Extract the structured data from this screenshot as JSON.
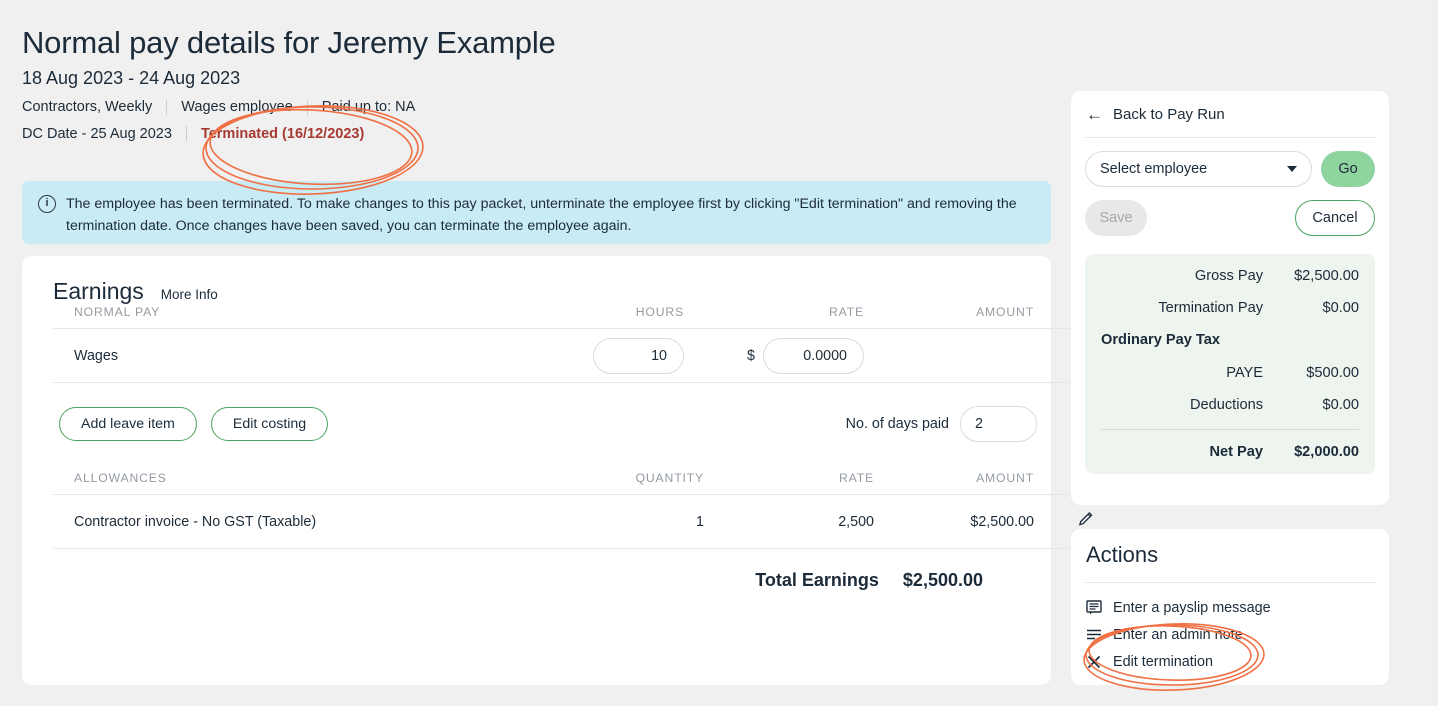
{
  "header": {
    "title": "Normal pay details for Jeremy Example",
    "date_range": "18 Aug 2023 - 24 Aug 2023",
    "meta1": "Contractors, Weekly",
    "meta2": "Wages employee",
    "meta3": "Paid up to: NA",
    "dc_date": "DC Date - 25 Aug 2023",
    "terminated_badge": "Terminated (16/12/2023)",
    "terminated_color": "#a63a32"
  },
  "banner": {
    "icon": "info-circle-icon",
    "text": "The employee has been terminated. To make changes to this pay packet, unterminate the employee first by clicking \"Edit termination\" and removing the termination date. Once changes have been saved, you can terminate the employee again.",
    "background": "#c9ebf6"
  },
  "earnings": {
    "title": "Earnings",
    "more_info": "More Info",
    "normal_pay": {
      "columns": [
        "NORMAL PAY",
        "HOURS",
        "RATE",
        "AMOUNT"
      ],
      "rows": [
        {
          "name": "Wages",
          "hours": "10",
          "currency_symbol": "$",
          "rate": "0.0000",
          "amount": ""
        }
      ]
    },
    "buttons": {
      "add_leave_item": "Add leave item",
      "edit_costing": "Edit costing"
    },
    "days_paid": {
      "label": "No. of days paid",
      "value": "2"
    },
    "allowances": {
      "columns": [
        "ALLOWANCES",
        "QUANTITY",
        "RATE",
        "AMOUNT"
      ],
      "rows": [
        {
          "name": "Contractor invoice - No GST (Taxable)",
          "quantity": "1",
          "rate": "2,500",
          "amount": "$2,500.00",
          "edit_icon": "pencil-icon"
        }
      ]
    },
    "total": {
      "label": "Total Earnings",
      "value": "$2,500.00"
    }
  },
  "pay_panel": {
    "back_link": "Back to Pay Run",
    "back_icon": "arrow-left-icon",
    "employee_select": {
      "value": "Select employee",
      "caret": "chevron-down-icon"
    },
    "go_button": "Go",
    "go_color": "#8ed49f",
    "save_button": "Save",
    "cancel_button": "Cancel",
    "summary": {
      "gross_pay_label": "Gross Pay",
      "gross_pay_value": "$2,500.00",
      "termination_pay_label": "Termination Pay",
      "termination_pay_value": "$0.00",
      "section_label": "Ordinary Pay Tax",
      "paye_label": "PAYE",
      "paye_value": "$500.00",
      "deductions_label": "Deductions",
      "deductions_value": "$0.00",
      "net_pay_label": "Net Pay",
      "net_pay_value": "$2,000.00"
    }
  },
  "actions": {
    "title": "Actions",
    "items": [
      {
        "label": "Enter a payslip message",
        "icon": "message-icon"
      },
      {
        "label": "Enter an admin note",
        "icon": "note-lines-icon"
      },
      {
        "label": "Edit termination",
        "icon": "close-x-icon"
      }
    ]
  },
  "annotations": {
    "color": "#ef7044",
    "circle_terminated": "ellipse highlighting Terminated (16/12/2023)",
    "circle_edit_termination": "ellipse highlighting Edit termination action"
  }
}
